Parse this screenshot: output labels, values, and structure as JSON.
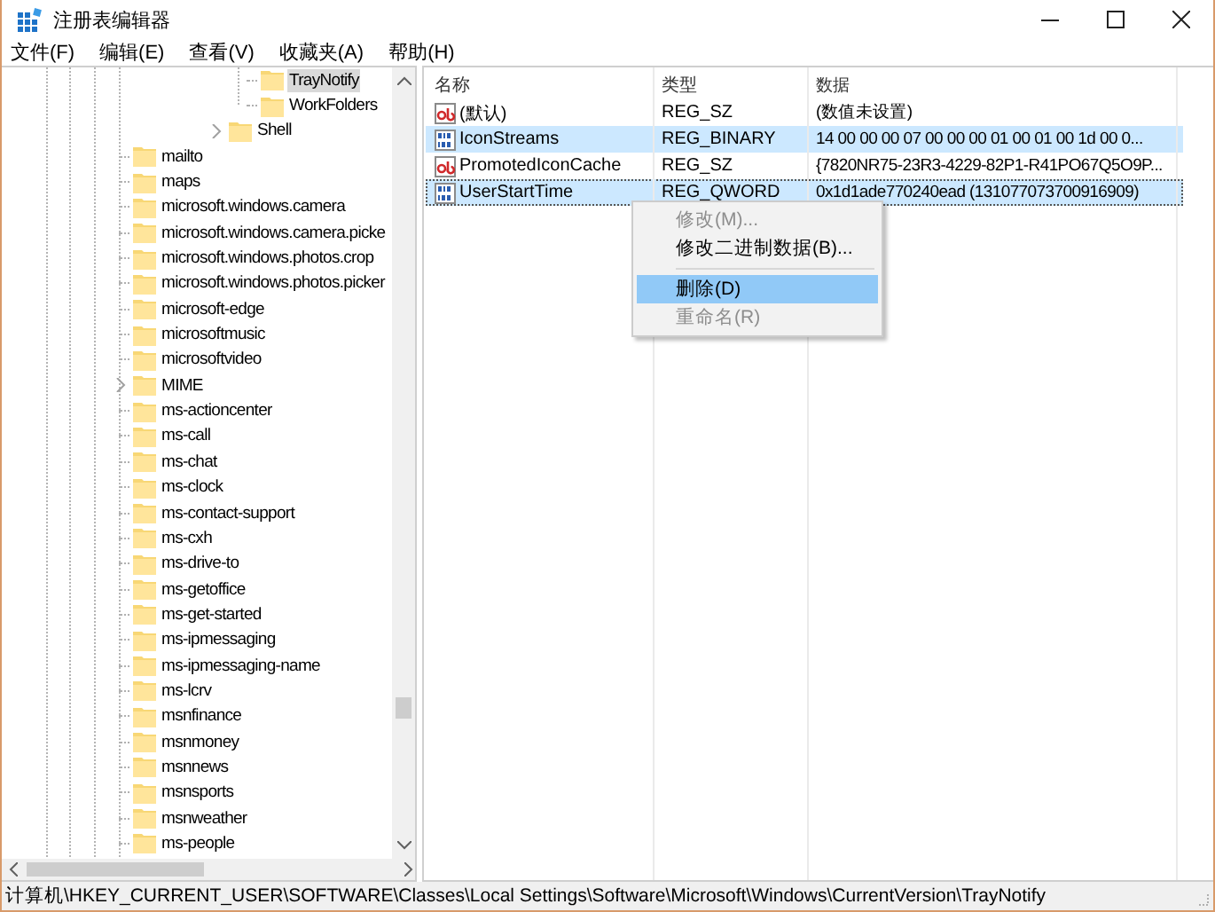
{
  "window": {
    "title": "注册表编辑器"
  },
  "menu_bar": [
    "文件(F)",
    "编辑(E)",
    "查看(V)",
    "收藏夹(A)",
    "帮助(H)"
  ],
  "tree": [
    {
      "children": [
        {
          "children": [
            {
              "children": [
                {
                  "children": [
                    {
                      "label": "TrayNotify",
                      "selected": true
                    },
                    {
                      "label": "WorkFolders",
                      "selected": false
                    }
                  ]
                },
                {
                  "label": "Shell",
                  "selected": false,
                  "expanded": false
                }
              ]
            }
          ]
        }
      ]
    },
    {
      "label": "mailto",
      "selected": false
    },
    {
      "label": "maps",
      "selected": false
    },
    {
      "label": "microsoft.windows.camera",
      "selected": false
    },
    {
      "label": "microsoft.windows.camera.picke",
      "selected": false
    },
    {
      "label": "microsoft.windows.photos.crop",
      "selected": false
    },
    {
      "label": "microsoft.windows.photos.picker",
      "selected": false
    },
    {
      "label": "microsoft-edge",
      "selected": false
    },
    {
      "label": "microsoftmusic",
      "selected": false
    },
    {
      "label": "microsoftvideo",
      "selected": false
    },
    {
      "label": "MIME",
      "selected": false,
      "expanded": false
    },
    {
      "label": "ms-actioncenter",
      "selected": false
    },
    {
      "label": "ms-call",
      "selected": false
    },
    {
      "label": "ms-chat",
      "selected": false
    },
    {
      "label": "ms-clock",
      "selected": false
    },
    {
      "label": "ms-contact-support",
      "selected": false
    },
    {
      "label": "ms-cxh",
      "selected": false
    },
    {
      "label": "ms-drive-to",
      "selected": false
    },
    {
      "label": "ms-getoffice",
      "selected": false
    },
    {
      "label": "ms-get-started",
      "selected": false
    },
    {
      "label": "ms-ipmessaging",
      "selected": false
    },
    {
      "label": "ms-ipmessaging-name",
      "selected": false
    },
    {
      "label": "ms-lcrv",
      "selected": false
    },
    {
      "label": "msnfinance",
      "selected": false
    },
    {
      "label": "msnmoney",
      "selected": false
    },
    {
      "label": "msnnews",
      "selected": false
    },
    {
      "label": "msnsports",
      "selected": false
    },
    {
      "label": "msnweather",
      "selected": false
    },
    {
      "label": "ms-people",
      "selected": false
    }
  ],
  "table": {
    "columns": [
      "名称",
      "类型",
      "数据"
    ],
    "rows": [
      {
        "kind": "string",
        "name": "(默认)",
        "type": "REG_SZ",
        "data": "(数值未设置)",
        "selected": false,
        "focused": false
      },
      {
        "kind": "binary",
        "name": "IconStreams",
        "type": "REG_BINARY",
        "data": "14 00 00 00 07 00 00 00 01 00 01 00 1d 00 0...",
        "selected": true,
        "focused": false
      },
      {
        "kind": "string",
        "name": "PromotedIconCache",
        "type": "REG_SZ",
        "data": "{7820NR75-23R3-4229-82P1-R41PO67Q5O9P...",
        "selected": false,
        "focused": false
      },
      {
        "kind": "binary",
        "name": "UserStartTime",
        "type": "REG_QWORD",
        "data": "0x1d1ade770240ead (131077073700916909)",
        "selected": true,
        "focused": true
      }
    ]
  },
  "context_menu": [
    {
      "kind": "item",
      "label": "修改(M)...",
      "disabled": true,
      "selected": false
    },
    {
      "kind": "item",
      "label": "修改二进制数据(B)...",
      "disabled": false,
      "selected": false
    },
    {
      "kind": "separator"
    },
    {
      "kind": "item",
      "label": "删除(D)",
      "disabled": false,
      "selected": true
    },
    {
      "kind": "item",
      "label": "重命名(R)",
      "disabled": true,
      "selected": false
    }
  ],
  "status_bar": "计算机\\HKEY_CURRENT_USER\\SOFTWARE\\Classes\\Local Settings\\Software\\Microsoft\\Windows\\CurrentVersion\\TrayNotify"
}
